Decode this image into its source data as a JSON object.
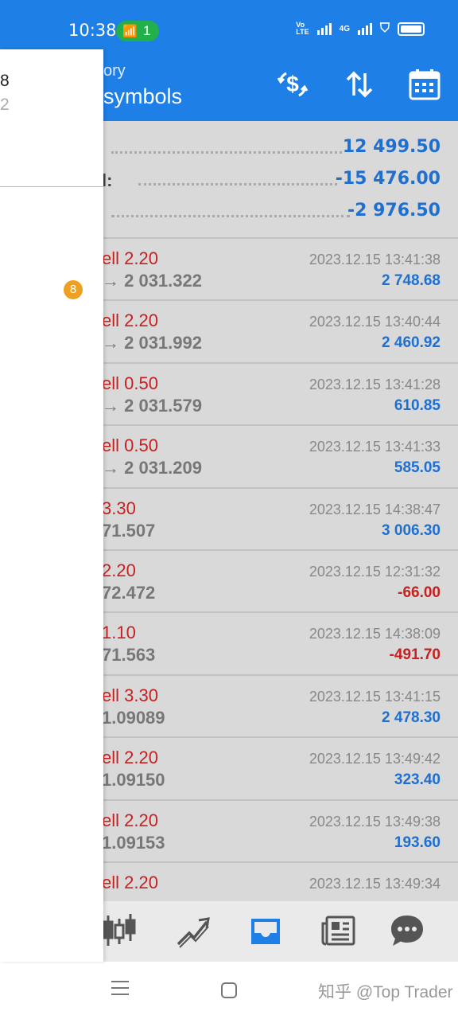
{
  "status_bar": {
    "time": "10:38",
    "hotspot_count": "1",
    "network_label": "4G"
  },
  "header": {
    "subtitle": "ory",
    "title": "symbols"
  },
  "summary": [
    {
      "label": "",
      "value": "12 499.50"
    },
    {
      "label": "l:",
      "value": "-15 476.00"
    },
    {
      "label": "",
      "value": "-2 976.50"
    }
  ],
  "deals": [
    {
      "type": "ell 2.20",
      "price": "→ 2 031.322",
      "date": "2023.12.15 13:41:38",
      "profit": "2 748.68",
      "sign": "pos"
    },
    {
      "type": "ell 2.20",
      "price": "→ 2 031.992",
      "date": "2023.12.15 13:40:44",
      "profit": "2 460.92",
      "sign": "pos"
    },
    {
      "type": "ell 0.50",
      "price": "→ 2 031.579",
      "date": "2023.12.15 13:41:28",
      "profit": "610.85",
      "sign": "pos"
    },
    {
      "type": "ell 0.50",
      "price": "→ 2 031.209",
      "date": "2023.12.15 13:41:33",
      "profit": "585.05",
      "sign": "pos"
    },
    {
      "type": "3.30",
      "price": "71.507",
      "date": "2023.12.15 14:38:47",
      "profit": "3 006.30",
      "sign": "pos"
    },
    {
      "type": "2.20",
      "price": "72.472",
      "date": "2023.12.15 12:31:32",
      "profit": "-66.00",
      "sign": "neg"
    },
    {
      "type": "1.10",
      "price": "71.563",
      "date": "2023.12.15 14:38:09",
      "profit": "-491.70",
      "sign": "neg"
    },
    {
      "type": "ell 3.30",
      "price": "1.09089",
      "date": "2023.12.15 13:41:15",
      "profit": "2 478.30",
      "sign": "pos"
    },
    {
      "type": "ell 2.20",
      "price": "1.09150",
      "date": "2023.12.15 13:49:42",
      "profit": "323.40",
      "sign": "pos"
    },
    {
      "type": "ell 2.20",
      "price": "1.09153",
      "date": "2023.12.15 13:49:38",
      "profit": "193.60",
      "sign": "pos"
    },
    {
      "type": "ell 2.20",
      "price": "",
      "date": "2023.12.15 13:49:34",
      "profit": "",
      "sign": "pos"
    }
  ],
  "drawer": {
    "value1": "8",
    "value2": "2",
    "badge": "8"
  },
  "watermark": "知乎 @Top Trader",
  "colors": {
    "brand": "#1e7fe6",
    "profit_positive": "#1e6fd0",
    "profit_negative": "#c62020",
    "sell": "#c62020",
    "badge": "#f0a020"
  },
  "tabs": [
    {
      "icon": "candlestick-icon",
      "active": false
    },
    {
      "icon": "trend-chart-icon",
      "active": false
    },
    {
      "icon": "inbox-tray-icon",
      "active": true
    },
    {
      "icon": "newspaper-icon",
      "active": false
    },
    {
      "icon": "chat-bubble-icon",
      "active": false
    }
  ]
}
